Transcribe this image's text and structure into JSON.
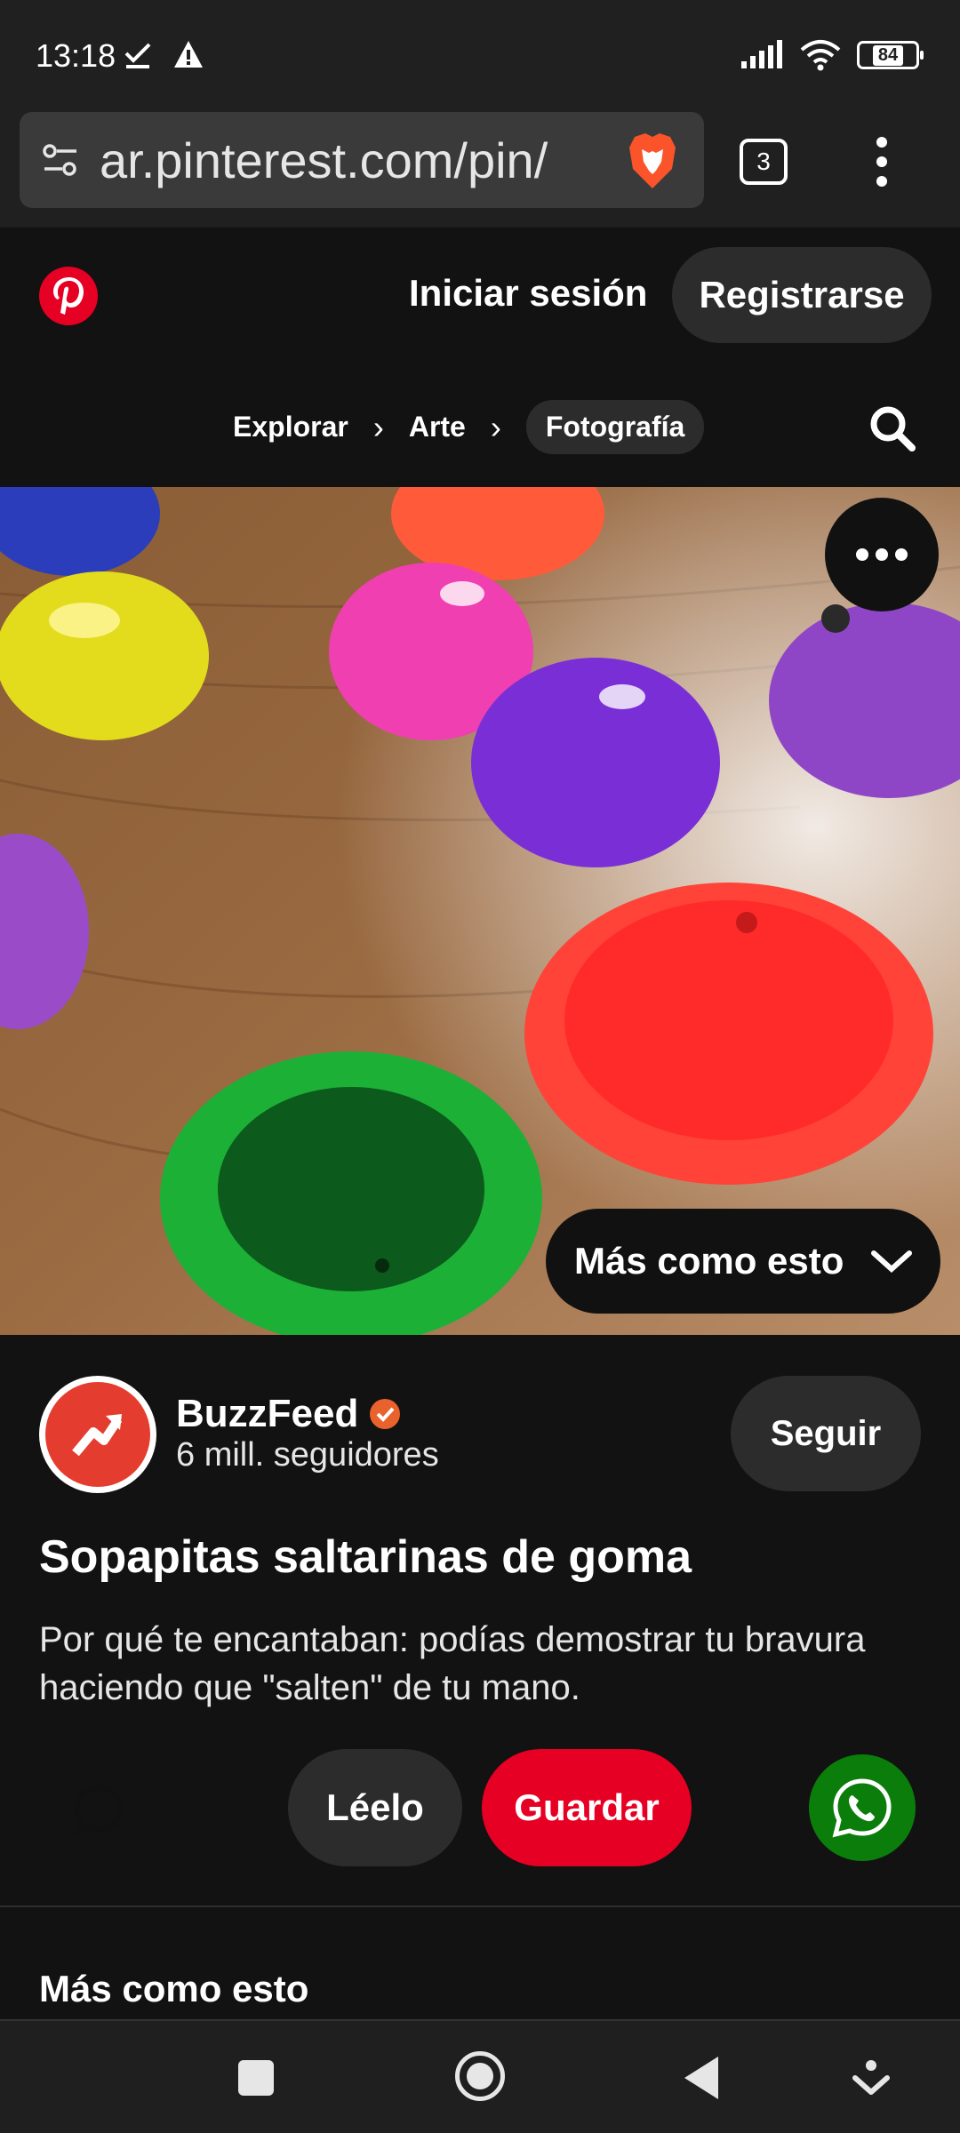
{
  "status_bar": {
    "time": "13:18",
    "battery": "84",
    "icons": [
      "check-icon",
      "warning-icon",
      "signal-icon",
      "wifi-icon",
      "battery-icon"
    ]
  },
  "browser": {
    "url": "ar.pinterest.com/pin/",
    "tab_count": "3",
    "icons": [
      "site-settings-icon",
      "brave-shield-icon",
      "tabs-icon",
      "overflow-menu-icon"
    ]
  },
  "header": {
    "login_label": "Iniciar sesión",
    "signup_label": "Registrarse"
  },
  "breadcrumb": {
    "items": [
      "Explorar",
      "Arte",
      "Fotografía"
    ]
  },
  "image": {
    "more_like_label": "Más como esto"
  },
  "author": {
    "name": "BuzzFeed",
    "followers": "6 mill. seguidores",
    "follow_label": "Seguir"
  },
  "pin": {
    "title": "Sopapitas saltarinas de goma",
    "description": "Por qué te encantaban: podías demostrar tu bravura haciendo que \"salten\" de tu mano."
  },
  "actions": {
    "read_label": "Léelo",
    "save_label": "Guardar"
  },
  "section": {
    "title": "Más como esto"
  },
  "colors": {
    "pinterest_red": "#e60023",
    "whatsapp_green": "#0b7d0b",
    "background": "#121212",
    "pill_bg": "#2c2c2c"
  }
}
